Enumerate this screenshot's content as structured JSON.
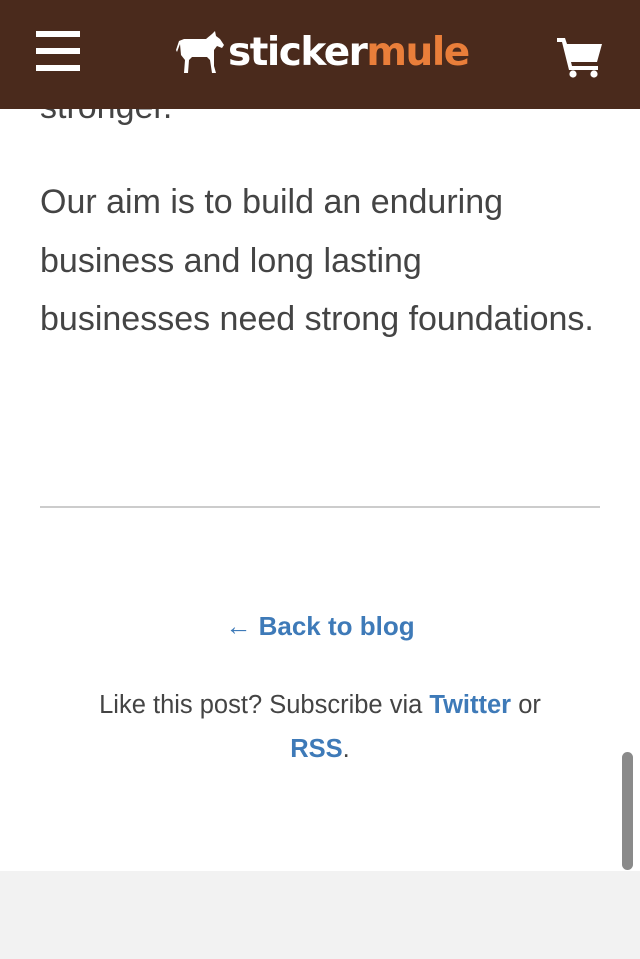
{
  "header": {
    "logo_word_1": "sticker",
    "logo_word_2": "mule",
    "menu_icon": "hamburger-menu-icon",
    "cart_icon": "shopping-cart-icon",
    "background_color": "#4a2a1c",
    "accent_color": "#e97e3a"
  },
  "article": {
    "partial_line": "stronger.",
    "paragraph": "Our aim is to build an enduring business and long lasting businesses need strong foundations."
  },
  "footer_nav": {
    "back_arrow": "←",
    "back_label": "Back to blog",
    "subscribe_prefix": "Like this post? Subscribe via",
    "twitter_label": "Twitter",
    "or_text": "or",
    "rss_label": "RSS",
    "period": ".",
    "link_color": "#3e7ab8"
  }
}
